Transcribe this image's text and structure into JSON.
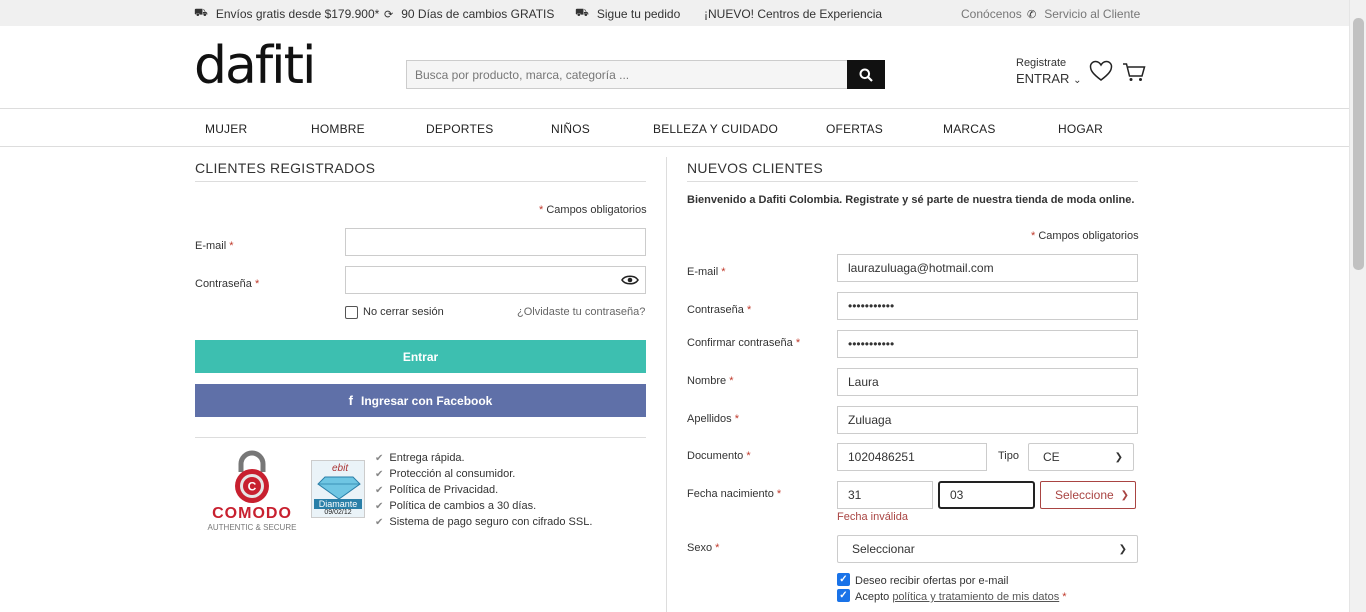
{
  "topbar": {
    "shipping": "Envíos gratis desde $179.900*",
    "returns": "90 Días de cambios GRATIS",
    "track": "Sigue tu pedido",
    "news": "¡NUEVO! Centros de Experiencia",
    "about": "Conócenos",
    "service": "Servicio al Cliente"
  },
  "header": {
    "logo": "dafiti",
    "search_placeholder": "Busca por producto, marca, categoría ...",
    "register": "Registrate",
    "enter": "ENTRAR"
  },
  "nav": [
    "MUJER",
    "HOMBRE",
    "DEPORTES",
    "NIÑOS",
    "BELLEZA Y CUIDADO",
    "OFERTAS",
    "MARCAS",
    "HOGAR"
  ],
  "login": {
    "title": "CLIENTES REGISTRADOS",
    "required_note": "Campos obligatorios",
    "email_label": "E-mail",
    "password_label": "Contraseña",
    "keep_session": "No cerrar sesión",
    "forgot": "¿Olvidaste tu contraseña?",
    "enter_btn": "Entrar",
    "facebook_btn": "Ingresar con Facebook"
  },
  "trust": {
    "comodo": "COMODO",
    "comodo_sub": "AUTHENTIC & SECURE",
    "ebit": "ebit",
    "diamante": "Diamante",
    "diamante_date": "09/02/12",
    "items": [
      "Entrega rápida.",
      "Protección al consumidor.",
      "Política de Privacidad.",
      "Política de cambios a 30 días.",
      "Sistema de pago seguro con cifrado SSL."
    ]
  },
  "register": {
    "title": "NUEVOS CLIENTES",
    "description": "Bienvenido a Dafiti Colombia. Registrate y sé parte de nuestra tienda de moda online.",
    "required_note": "Campos obligatorios",
    "email_label": "E-mail",
    "email_value": "laurazuluaga@hotmail.com",
    "password_label": "Contraseña",
    "password_value": "•••••••••••",
    "confirm_label": "Confirmar contraseña",
    "confirm_value": "•••••••••••",
    "name_label": "Nombre",
    "name_value": "Laura",
    "surname_label": "Apellidos",
    "surname_value": "Zuluaga",
    "doc_label": "Documento",
    "doc_value": "1020486251",
    "type_label": "Tipo",
    "type_value": "CE",
    "birth_label": "Fecha nacimiento",
    "birth_day": "31",
    "birth_month": "03",
    "birth_year": "Seleccione",
    "birth_error": "Fecha inválida",
    "sex_label": "Sexo",
    "sex_value": "Seleccionar",
    "offers": "Deseo recibir ofertas por e-mail",
    "accept_prefix": "Acepto",
    "accept_link": "política y tratamiento de mis datos"
  }
}
